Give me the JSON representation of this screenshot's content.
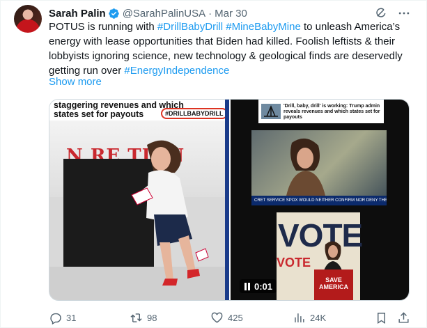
{
  "author": {
    "name": "Sarah Palin",
    "handle": "@SarahPalinUSA",
    "date": "Mar 30"
  },
  "tweet": {
    "t1": "POTUS is running with ",
    "h1": "#DrillBabyDrill",
    "t2": " ",
    "h2": "#MineBabyMine",
    "t3": " to unleash America’s energy with lease opportunities that Biden had killed. Foolish leftists & their lobbyists ignoring science, new technology & geological finds are deservedly getting run over ",
    "h3": "#EnergyIndependence",
    "show_more": "Show more"
  },
  "media": {
    "left": {
      "headline": "staggering revenues and which states set for payouts",
      "hashtag": "#DRILLBABYDRILL",
      "banner_text": "N RE    TION",
      "banner_text2": "TION"
    },
    "right": {
      "headline": "'Drill, baby, drill' is working: Trump admin reveals revenues and which states set for payouts",
      "tv_bar": "CRET SERVICE SPOX WOULD NEITHER CONFIRM NOR DENY THE",
      "vote": "VOTE",
      "vote2": "VOTE",
      "sign": "SAVE AMERICA",
      "duration": "0:01"
    }
  },
  "actions": {
    "replies": "31",
    "reposts": "98",
    "likes": "425",
    "views": "24K"
  },
  "colors": {
    "link": "#1d9bf0",
    "muted": "#536471",
    "verified": "#1d9bf0"
  }
}
